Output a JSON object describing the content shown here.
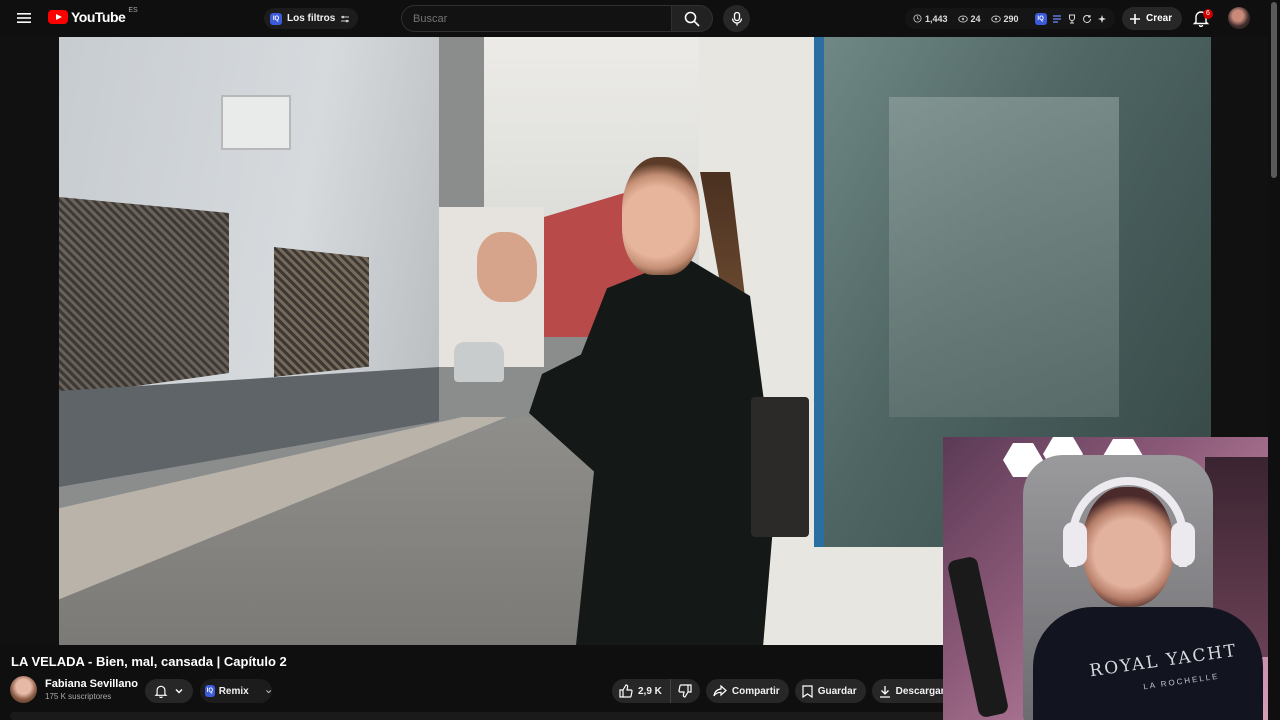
{
  "header": {
    "logo_text": "YouTube",
    "region": "ES",
    "filters_label": "Los filtros",
    "search_placeholder": "Buscar",
    "stats": [
      {
        "icon": "clock-icon",
        "value": "1,443"
      },
      {
        "icon": "eye-icon",
        "value": "24"
      },
      {
        "icon": "eye-icon",
        "value": "290"
      }
    ],
    "create_label": "Crear",
    "notifications_count": "6"
  },
  "video": {
    "title": "LA VELADA - Bien, mal, cansada | Capítulo 2"
  },
  "channel": {
    "name": "Fabiana Sevillano",
    "subscribers": "175 K suscriptores"
  },
  "actions": {
    "remix_label": "Remix",
    "like_count": "2,9 K",
    "share_label": "Compartir",
    "save_label": "Guardar",
    "download_label": "Descargar"
  },
  "webcam": {
    "shirt_text": "ROYAL YACHT",
    "shirt_sub": "LA ROCHELLE"
  },
  "colors": {
    "background": "#0f0f0f",
    "brand_red": "#ff0000",
    "chip": "#272727",
    "notification": "#cc0000"
  }
}
